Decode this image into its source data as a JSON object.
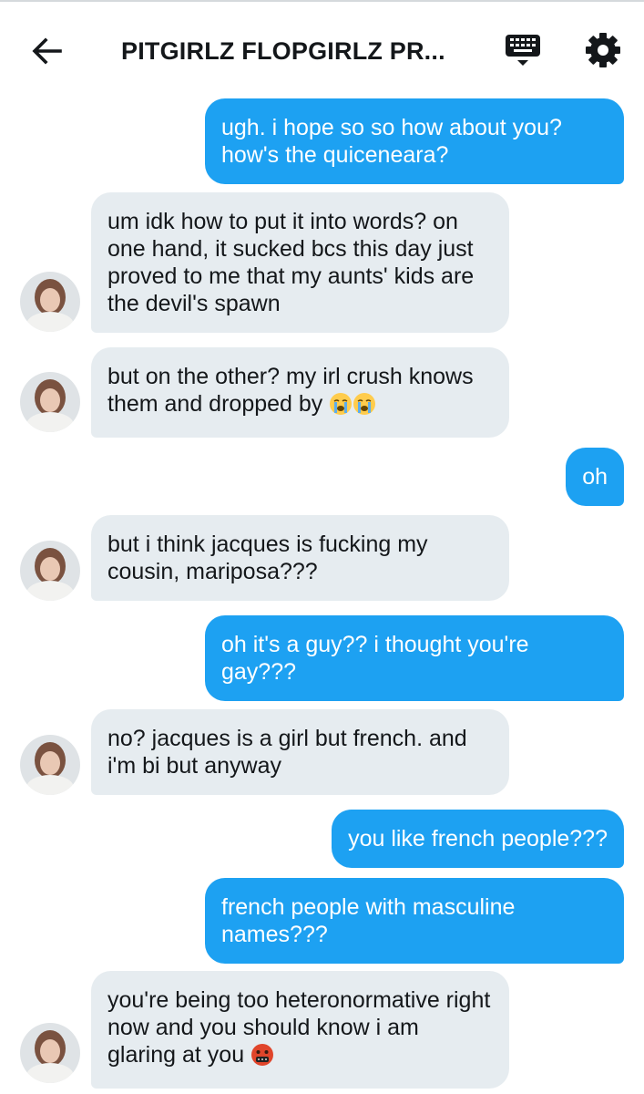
{
  "header": {
    "title": "PITGIRLZ FLOPGIRLZ PR...",
    "back_icon": "arrow-left-icon",
    "keyboard_icon": "keyboard-icon",
    "settings_icon": "gear-icon"
  },
  "colors": {
    "sent_bubble": "#1da1f2",
    "received_bubble": "#e6ecf0",
    "text": "#14171a"
  },
  "messages": [
    {
      "direction": "sent",
      "text": "ugh. i hope so so how about you? how's the quiceneara?"
    },
    {
      "direction": "received",
      "text": "um idk how to put it into words? on one hand, it sucked bcs this day just proved to me that my aunts' kids are the devil's spawn"
    },
    {
      "direction": "received",
      "text": "but on the other? my irl crush knows them and dropped by",
      "emoji": [
        "loudly-crying-face-emoji",
        "loudly-crying-face-emoji"
      ]
    },
    {
      "direction": "sent",
      "text": "oh"
    },
    {
      "direction": "received",
      "text": "but i think jacques is fucking my cousin, mariposa???"
    },
    {
      "direction": "sent",
      "text": "oh it's a guy?? i thought you're gay???"
    },
    {
      "direction": "received",
      "text": "no? jacques is a girl but french. and i'm bi but anyway"
    },
    {
      "direction": "sent",
      "text": "you like french people???"
    },
    {
      "direction": "sent",
      "text": "french people with masculine names???"
    },
    {
      "direction": "received",
      "text": "you're being too heteronormative right now and you should know i am glaring at you",
      "emoji": [
        "face-with-symbols-on-mouth-emoji"
      ]
    }
  ]
}
